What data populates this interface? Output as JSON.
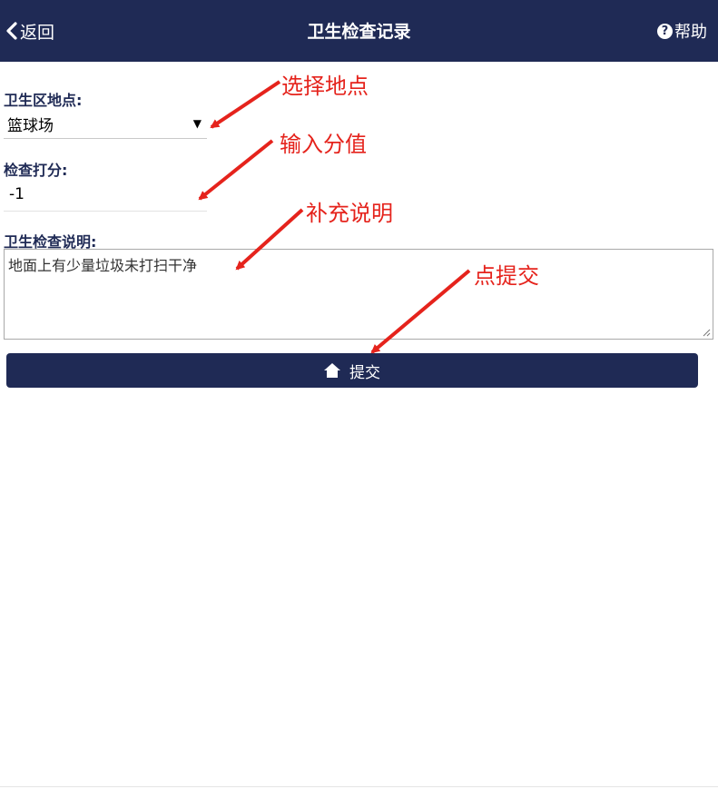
{
  "header": {
    "back_label": "返回",
    "title": "卫生检查记录",
    "help_label": "帮助",
    "bg_color": "#1f2a55"
  },
  "form": {
    "location_label": "卫生区地点:",
    "location_value": "篮球场",
    "score_label": "检查打分:",
    "score_value": "-1",
    "desc_label": "卫生检查说明:",
    "desc_value": "地面上有少量垃圾未打扫干净",
    "submit_label": "提交"
  },
  "annotations": {
    "select_place": "选择地点",
    "enter_score": "输入分值",
    "add_note": "补充说明",
    "click_submit": "点提交",
    "color": "#e5231c"
  }
}
